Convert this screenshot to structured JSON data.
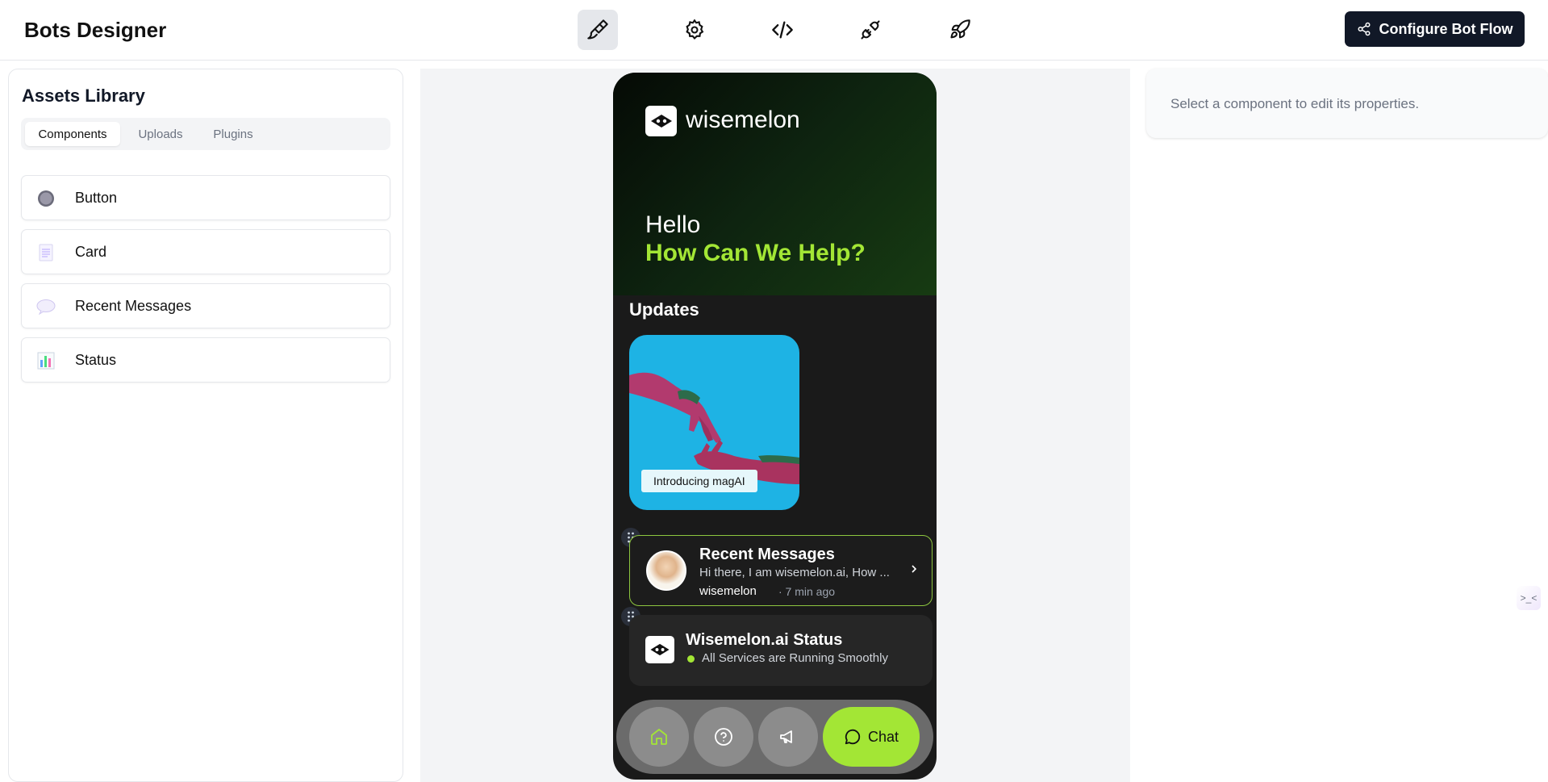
{
  "app": {
    "title": "Bots Designer"
  },
  "toolbar": {
    "tools": [
      "paintbrush-icon",
      "gear-icon",
      "code-icon",
      "plug-icon",
      "rocket-icon"
    ],
    "active_tool": "paintbrush-icon",
    "configure_label": "Configure Bot Flow"
  },
  "assets": {
    "title": "Assets Library",
    "tabs": [
      {
        "label": "Components",
        "active": true
      },
      {
        "label": "Uploads",
        "active": false
      },
      {
        "label": "Plugins",
        "active": false
      }
    ],
    "components": [
      {
        "label": "Button",
        "icon": "circle-button-icon"
      },
      {
        "label": "Card",
        "icon": "card-icon"
      },
      {
        "label": "Recent Messages",
        "icon": "speech-bubble-icon"
      },
      {
        "label": "Status",
        "icon": "bar-chart-icon"
      }
    ]
  },
  "preview": {
    "brand": "wisemelon",
    "greeting": "Hello",
    "subgreeting": "How Can We Help?",
    "updates_title": "Updates",
    "update_card": {
      "label": "Introducing magAI"
    },
    "recent": {
      "title": "Recent Messages",
      "snippet": "Hi there, I am wisemelon.ai, How ...",
      "from": "wisemelon",
      "time": "· 7 min ago"
    },
    "status": {
      "title": "Wisemelon.ai Status",
      "text": "All Services are Running Smoothly"
    },
    "nav": {
      "chat_label": "Chat"
    }
  },
  "properties": {
    "placeholder": "Select a component to edit its properties."
  },
  "float": {
    "label": ">_<"
  },
  "colors": {
    "accent": "#a3e635",
    "dark": "#111827"
  }
}
